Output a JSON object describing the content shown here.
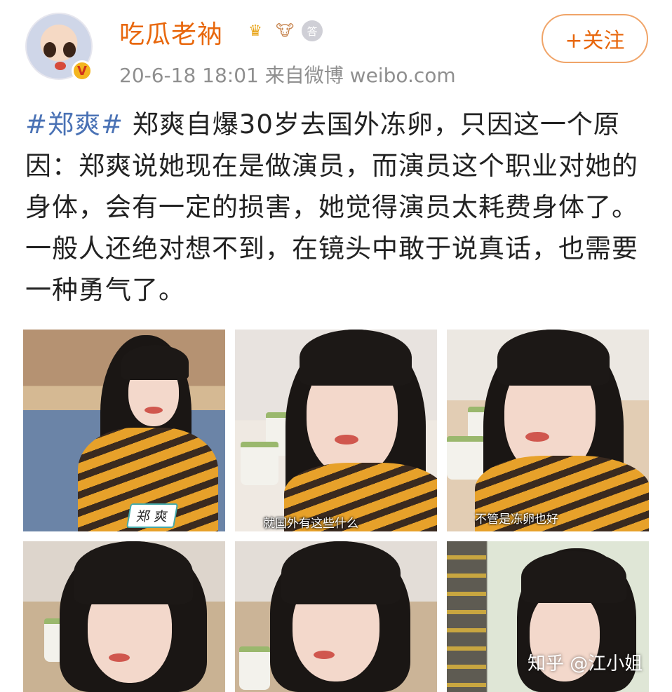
{
  "header": {
    "username": "吃瓜老衲",
    "timestamp": "20-6-18 18:01",
    "source": "来自微博 weibo.com",
    "follow_label": "+关注",
    "verified_badge": "V",
    "medals": [
      "crown-medal-icon",
      "cow-medal-icon",
      "silver-medal-icon"
    ],
    "silver_medal_text": "答"
  },
  "post": {
    "hashtag": "#郑爽#",
    "body": " 郑爽自爆30岁去国外冻卵，只因这一个原因：郑爽说她现在是做演员，而演员这个职业对她的身体，会有一定的损害，她觉得演员太耗费身体了。一般人还绝对想不到，在镜头中敢于说真话，也需要一种勇气了。"
  },
  "photos": {
    "p1_nametag": "郑 爽",
    "p2_caption": "就国外有这些什么",
    "p3_caption": "不管是冻卵也好"
  },
  "watermark": "知乎 @江小姐",
  "colors": {
    "username": "#e8670c",
    "hashtag": "#4a72b5",
    "meta": "#8f8f8f",
    "follow_border": "#f0a468"
  }
}
